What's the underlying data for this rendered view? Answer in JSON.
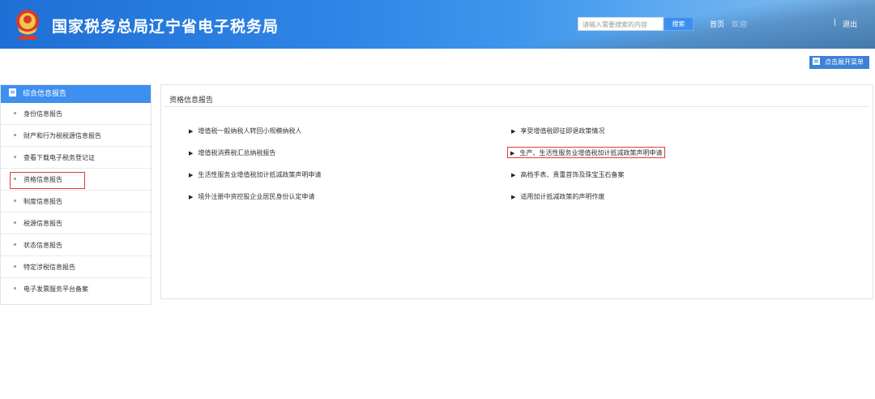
{
  "header": {
    "title": "国家税务总局辽宁省电子税务局",
    "search_placeholder": "请输入需要搜索的内容",
    "search_button": "搜索",
    "home_link": "首页",
    "welcome": "欢迎",
    "separator": "|",
    "logout": "退出",
    "colors": {
      "primary": "#2f86e6"
    }
  },
  "toolbar": {
    "expand_menu": "点击展开菜单"
  },
  "sidebar": {
    "heading": "综合信息报告",
    "items": [
      {
        "label": "身份信息报告"
      },
      {
        "label": "财产和行为税税源信息报告"
      },
      {
        "label": "查看下载电子税务登记证"
      },
      {
        "label": "资格信息报告"
      },
      {
        "label": "制度信息报告"
      },
      {
        "label": "税源信息报告"
      },
      {
        "label": "状态信息报告"
      },
      {
        "label": "特定涉税信息报告"
      },
      {
        "label": "电子发票服务平台备案"
      }
    ],
    "highlight_color": "#e03b3b"
  },
  "main": {
    "panel_title": "资格信息报告",
    "left_links": [
      {
        "label": "增值税一般纳税人转回小规模纳税人"
      },
      {
        "label": "增值税消费税汇总纳税报告"
      },
      {
        "label": "生活性服务业增值税加计抵减政策声明申请"
      },
      {
        "label": "境外注册中资控股企业居民身份认定申请"
      }
    ],
    "right_links": [
      {
        "label": "享受增值税即征即退政策情况"
      },
      {
        "label": "生产、生活性服务业增值税加计抵减政策声明申请"
      },
      {
        "label": "高档手表、贵重首饰及珠宝玉石备案"
      },
      {
        "label": "适用加计抵减政策的声明作废"
      }
    ],
    "bullet": "▶"
  }
}
